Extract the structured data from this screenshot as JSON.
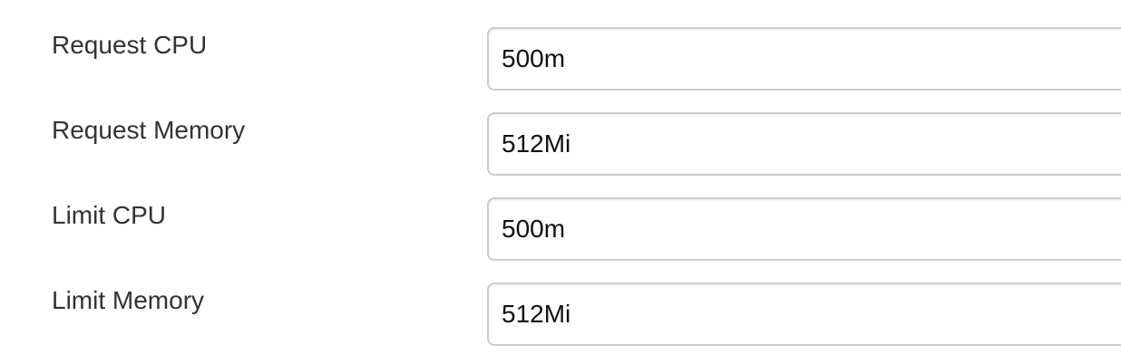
{
  "fields": [
    {
      "label": "Request CPU",
      "value": "500m"
    },
    {
      "label": "Request Memory",
      "value": "512Mi"
    },
    {
      "label": "Limit CPU",
      "value": "500m"
    },
    {
      "label": "Limit Memory",
      "value": "512Mi"
    }
  ]
}
